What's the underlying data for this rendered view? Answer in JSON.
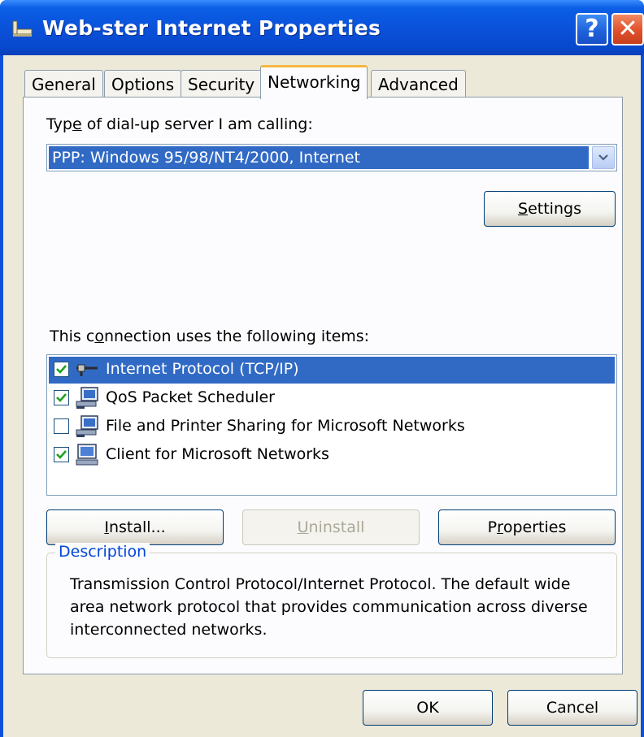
{
  "window": {
    "title": "Web-ster Internet Properties",
    "help_label": "?",
    "close_label": "✕"
  },
  "tabs": [
    {
      "label": "General"
    },
    {
      "label": "Options"
    },
    {
      "label": "Security"
    },
    {
      "label": "Networking",
      "active": true
    },
    {
      "label": "Advanced"
    }
  ],
  "server_type": {
    "label_a": "Typ",
    "label_key": "e",
    "label_b": " of dial-up server I am calling:",
    "selected": "PPP: Windows 95/98/NT4/2000, Internet"
  },
  "settings_button": {
    "key": "S",
    "rest": "ettings"
  },
  "items_section": {
    "label_a": "This c",
    "label_key": "o",
    "label_b": "nnection uses the following items:",
    "items": [
      {
        "label": "Internet Protocol (TCP/IP)",
        "checked": true,
        "selected": true,
        "icon": "network-protocol-icon"
      },
      {
        "label": "QoS Packet Scheduler",
        "checked": true,
        "selected": false,
        "icon": "network-service-icon"
      },
      {
        "label": "File and Printer Sharing for Microsoft Networks",
        "checked": false,
        "selected": false,
        "icon": "network-service-icon"
      },
      {
        "label": "Client for Microsoft Networks",
        "checked": true,
        "selected": false,
        "icon": "network-client-icon"
      }
    ]
  },
  "install_button": {
    "key": "I",
    "rest": "nstall..."
  },
  "uninstall_button": {
    "key": "U",
    "rest": "ninstall"
  },
  "properties_button": {
    "pre": "P",
    "key": "r",
    "rest": "operties"
  },
  "description": {
    "title": "Description",
    "text": "Transmission Control Protocol/Internet Protocol. The default wide area network protocol that provides communication across diverse interconnected networks."
  },
  "footer": {
    "ok_label": "OK",
    "cancel_label": "Cancel"
  },
  "colors": {
    "selection": "#316ac5",
    "titlebar": "#0a52da",
    "dialog_bg": "#ece9d8",
    "tab_highlight": "#f5b73f"
  }
}
